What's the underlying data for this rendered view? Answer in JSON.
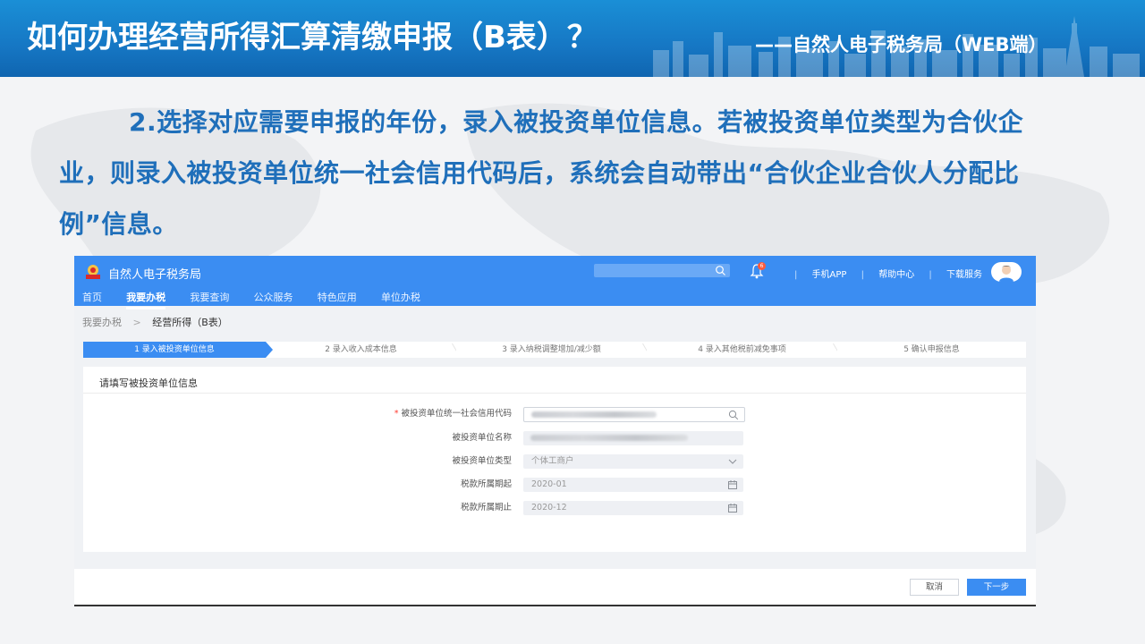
{
  "slide": {
    "title": "如何办理经营所得汇算清缴申报（B表）？",
    "subtitle": "——自然人电子税务局（WEB端）",
    "instruction": "2.选择对应需要申报的年份，录入被投资单位信息。若被投资单位类型为合伙企业，则录入被投资单位统一社会信用代码后，系统会自动带出“合伙企业合伙人分配比例”信息。"
  },
  "app": {
    "name": "自然人电子税务局",
    "search_placeholder": "",
    "bell_count": "6",
    "top_links": [
      "手机APP",
      "帮助中心",
      "下载服务"
    ],
    "nav": [
      "首页",
      "我要办税",
      "我要查询",
      "公众服务",
      "特色应用",
      "单位办税"
    ],
    "active_nav": "我要办税",
    "breadcrumb": [
      "我要办税",
      "经营所得（B表）"
    ],
    "steps": [
      "1 录入被投资单位信息",
      "2 录入收入成本信息",
      "3 录入纳税调整增加/减少额",
      "4 录入其他税前减免事项",
      "5 确认申报信息"
    ],
    "active_step": 0,
    "panel_title": "请填写被投资单位信息",
    "fields": [
      {
        "label": "被投资单位统一社会信用代码",
        "required": true,
        "value": "",
        "icon": "search-icon"
      },
      {
        "label": "被投资单位名称",
        "required": false,
        "value": "",
        "icon": ""
      },
      {
        "label": "被投资单位类型",
        "required": false,
        "value": "个体工商户",
        "icon": "chevron-down-icon"
      },
      {
        "label": "税款所属期起",
        "required": false,
        "value": "2020-01",
        "icon": "calendar-icon"
      },
      {
        "label": "税款所属期止",
        "required": false,
        "value": "2020-12",
        "icon": "calendar-icon"
      }
    ],
    "buttons": {
      "cancel": "取消",
      "next": "下一步"
    },
    "colors": {
      "primary": "#3b8df2",
      "slide_blue": "#1677c4",
      "text_blue": "#1f6fba"
    }
  }
}
